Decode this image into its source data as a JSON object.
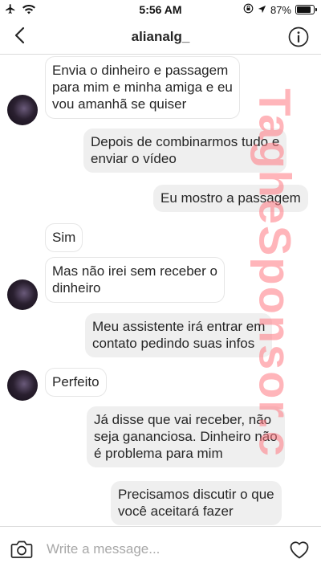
{
  "status_bar": {
    "time": "5:56 AM",
    "battery_percent": "87%",
    "battery_level": 0.87
  },
  "header": {
    "title": "alianalg_",
    "back_icon": "chevron-left-icon",
    "info_icon": "info-icon"
  },
  "messages": [
    {
      "direction": "incoming",
      "text": "Envia o dinheiro e passagem\npara mim e minha amiga e eu\nvou amanhã se quiser"
    },
    {
      "direction": "outgoing",
      "text": "Depois de combinarmos tudo e\nenviar o vídeo"
    },
    {
      "direction": "outgoing",
      "text": "Eu mostro a passagem"
    },
    {
      "direction": "incoming",
      "text": "Sim"
    },
    {
      "direction": "incoming",
      "text": "Mas não irei sem receber o\ndinheiro"
    },
    {
      "direction": "outgoing",
      "text": "Meu assistente irá entrar em\ncontato pedindo suas infos"
    },
    {
      "direction": "incoming",
      "text": "Perfeito"
    },
    {
      "direction": "outgoing",
      "text": "Já disse que vai receber, não\nseja gananciosa. Dinheiro não\né problema para mim"
    },
    {
      "direction": "outgoing",
      "text": "Precisamos discutir o que\nvocê aceitará fazer"
    }
  ],
  "watermark": "TagheSponsor.c",
  "composer": {
    "placeholder": "Write a message...",
    "camera_icon": "camera-icon",
    "heart_icon": "heart-icon"
  },
  "colors": {
    "outgoing_bubble": "#efefef",
    "incoming_bubble": "#ffffff",
    "divider": "#dbdbdb",
    "watermark": "#ff7882"
  }
}
